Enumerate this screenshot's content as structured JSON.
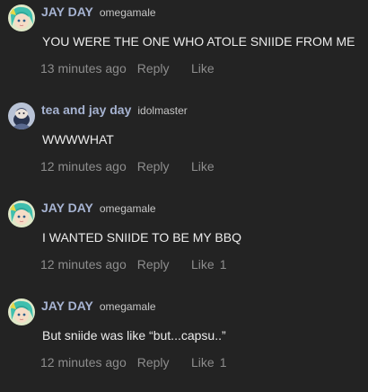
{
  "comments": [
    {
      "author": "JAY DAY",
      "flair": "omegamale",
      "avatar_icon": "anime-character-avatar-icon",
      "text": "YOU WERE THE ONE WHO ATOLE SNIIDE FROM ME",
      "time": "13 minutes ago",
      "reply_label": "Reply",
      "like_label": "Like",
      "like_count": ""
    },
    {
      "author": "tea and jay day",
      "flair": "idolmaster",
      "avatar_icon": "character-avatar-icon",
      "text": "WWWWHAT",
      "time": "12 minutes ago",
      "reply_label": "Reply",
      "like_label": "Like",
      "like_count": ""
    },
    {
      "author": "JAY DAY",
      "flair": "omegamale",
      "avatar_icon": "anime-character-avatar-icon",
      "text": "I WANTED SNIIDE TO BE MY BBQ",
      "time": "12 minutes ago",
      "reply_label": "Reply",
      "like_label": "Like",
      "like_count": "1"
    },
    {
      "author": "JAY DAY",
      "flair": "omegamale",
      "avatar_icon": "anime-character-avatar-icon",
      "text": "But sniide was like “but...capsu..”",
      "time": "12 minutes ago",
      "reply_label": "Reply",
      "like_label": "Like",
      "like_count": "1"
    }
  ],
  "colors": {
    "background": "#232323",
    "author": "#a6b3d1",
    "body_text": "#ececec",
    "meta": "#8d8d8d"
  }
}
